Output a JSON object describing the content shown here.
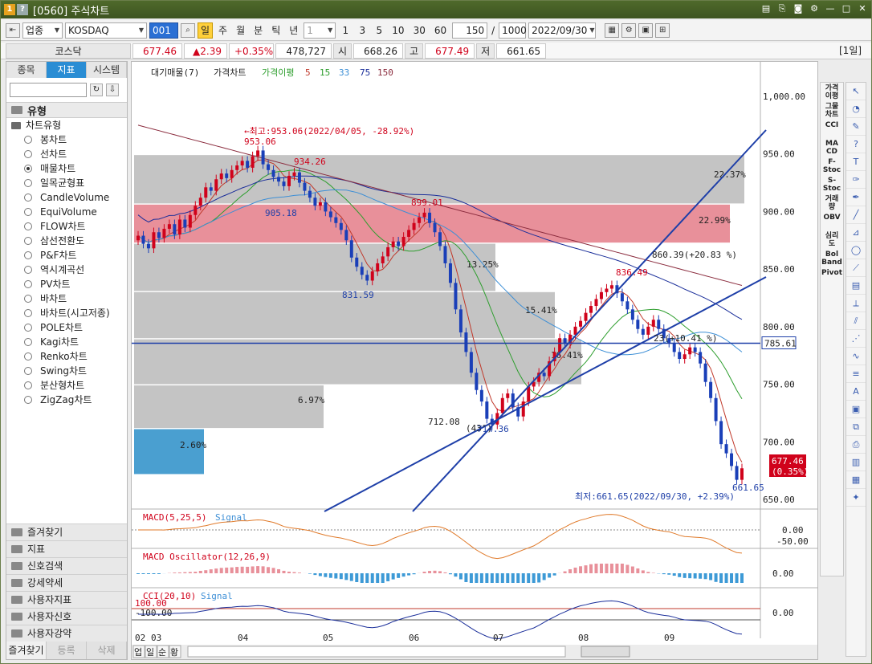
{
  "window": {
    "title": "[0560] 주식차트",
    "badge1": "1",
    "badge2": "?"
  },
  "toolbar": {
    "market_select": "업종",
    "code_input": "KOSDAQ",
    "code_chip": "001",
    "periods": [
      "일",
      "주",
      "월",
      "분",
      "틱",
      "년"
    ],
    "active_period": "일",
    "minute_select": "1",
    "intervals": [
      "1",
      "3",
      "5",
      "10",
      "30",
      "60"
    ],
    "count_value": "150",
    "separator": "/",
    "total_value": "1000",
    "date_value": "2022/09/30"
  },
  "quote": {
    "name": "코스닥",
    "price": "677.46",
    "change": "▲2.39",
    "change_rate": "+0.35%",
    "volume": "478,727",
    "open_label": "시",
    "open_value": "668.26",
    "high_label": "고",
    "high_value": "677.49",
    "low_label": "저",
    "low_value": "661.65",
    "period_tag": "[1일]"
  },
  "left_panel": {
    "tabs": [
      "종목",
      "지표",
      "시스템"
    ],
    "active_tab": "지표",
    "section_title": "유형",
    "tree_root": "차트유형",
    "items": [
      "봉차트",
      "선차트",
      "매물차트",
      "일목균형표",
      "CandleVolume",
      "EquiVolume",
      "FLOW차트",
      "삼선전환도",
      "P&F차트",
      "역시계곡선",
      "PV차트",
      "바차트",
      "바차트(시고저종)",
      "POLE차트",
      "Kagi차트",
      "Renko차트",
      "Swing차트",
      "분산형차트",
      "ZigZag차트"
    ],
    "selected_item": "매물차트",
    "bottom_items": [
      "즐겨찾기",
      "지표",
      "신호검색",
      "강세약세",
      "사용자지표",
      "사용자신호",
      "사용자강약"
    ],
    "footer": [
      "즐겨찾기",
      "등록",
      "삭제"
    ]
  },
  "chart": {
    "legend": {
      "vol_profile": "대기매물(7)",
      "price": "가격차트",
      "ma_label": "가격이평",
      "ma_periods": [
        "5",
        "15",
        "33",
        "75",
        "150"
      ]
    },
    "price_axis": [
      "1,000.00",
      "950.00",
      "900.00",
      "850.00",
      "800.00",
      "750.00",
      "700.00",
      "650.00"
    ],
    "current_line_label": "785.61",
    "current_price_tag": "677.46",
    "current_rate_tag": "(0.35%)",
    "max_annotation": "←최고:953.06(2022/04/05, -28.92%)",
    "min_annotation": "최저:661.65(2022/09/30, +2.39%)",
    "price_labels": {
      "p953": "953.06",
      "p934": "934.26",
      "p905": "905.18",
      "p899": "899.01",
      "p831": "831.59",
      "p836": "836.49",
      "p712": "712.08",
      "p661": "661.65",
      "p714": "714.36"
    },
    "trend_annotation_1": "860.39(+20.83 %)",
    "trend_annotation_2": "23(+10.41 %)",
    "trend_angle": "(43°)",
    "profile_pcts": [
      "22.37%",
      "22.99%",
      "13.25%",
      "15.41%",
      "16.41%",
      "6.97%",
      "2.60%"
    ],
    "x_axis": [
      "02",
      "03",
      "04",
      "05",
      "06",
      "07",
      "08",
      "09"
    ],
    "macd_label": "MACD(5,25,5)",
    "macd_signal": "Signal",
    "macd_axis": [
      "0.00",
      "-50.00"
    ],
    "osc_label": "MACD Oscillator(12,26,9)",
    "osc_axis": [
      "0.00"
    ],
    "cci_label": "CCI(20,10)",
    "cci_signal": "Signal",
    "cci_axis": [
      "100.00",
      "-100.00",
      "0.00"
    ],
    "bottom_tabs": [
      "업",
      "일",
      "순",
      "황"
    ]
  },
  "right_tools": [
    "가격\n이평",
    "그물\n차트",
    "CCI",
    "MA\nCD",
    "F-\nStoc",
    "S-\nStoc",
    "거래\n량",
    "OBV",
    "심리\n도",
    "Bol\nBand",
    "Pivot"
  ],
  "colors": {
    "title_bg": "#4f6a2b",
    "active_tab": "#2a8dd4",
    "up": "#d0021b",
    "down": "#1a3fb8",
    "profile_top": "#e8909a",
    "profile_low": "#4a9fd0"
  }
}
